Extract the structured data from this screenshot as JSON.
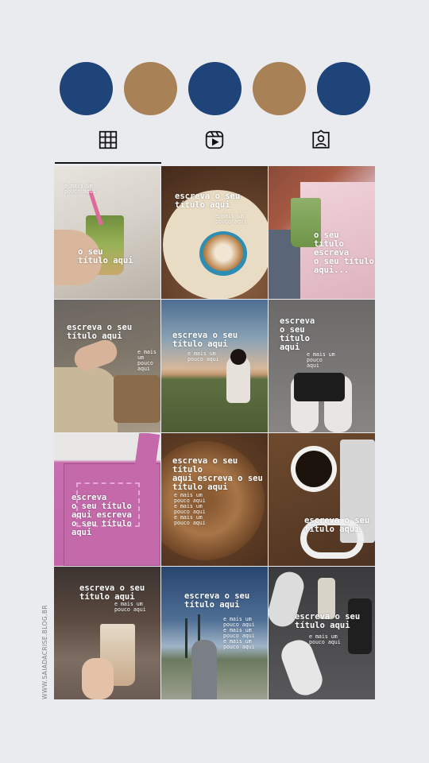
{
  "highlights": {
    "colors": [
      "#1f4479",
      "#a98157",
      "#1f4479",
      "#a98157",
      "#1f4479"
    ]
  },
  "tabs": {
    "items": [
      {
        "icon": "grid-icon",
        "active": true
      },
      {
        "icon": "reels-icon",
        "active": false
      },
      {
        "icon": "tagged-icon",
        "active": false
      }
    ]
  },
  "posts": [
    {
      "title": "o seu\ntítulo aqui",
      "sub": "e mais um\npouco aqui"
    },
    {
      "title": "escreva o seu\ntítulo aqui",
      "sub": "e mais um\npouco aqui"
    },
    {
      "title": "o seu\ntítulo escreva\no seu título\naqui..."
    },
    {
      "title": "escreva o seu título aqui",
      "sub": "e mais\num\npouco\naqui"
    },
    {
      "title": "escreva o seu\ntítulo aqui",
      "sub": "e mais um\npouco aqui"
    },
    {
      "title": "escreva\no seu\ntítulo\naqui",
      "sub": "e mais um\npouco\naqui"
    },
    {
      "title": "escreva\no seu título\naqui escreva\no seu título\naqui"
    },
    {
      "title": "escreva o seu título\naqui escreva o seu\ntítulo aqui",
      "sub": "e mais um\npouco aqui\ne mais um\npouco aqui\ne mais um\npouco aqui"
    },
    {
      "title": "escreva o seu\ntítulo aqui"
    },
    {
      "title": "escreva o seu\ntítulo aqui",
      "sub": "e mais um\npouco aqui"
    },
    {
      "title": "escreva o seu\ntítulo aqui",
      "sub": "e mais um\npouco aqui\ne mais um\npouco aqui\ne mais um\npouco aqui"
    },
    {
      "title": "escreva o seu\ntítulo aqui",
      "sub": "e mais um\npouco aqui"
    }
  ],
  "watermark": "WWW.SAIADACRISE.BLOG.BR"
}
